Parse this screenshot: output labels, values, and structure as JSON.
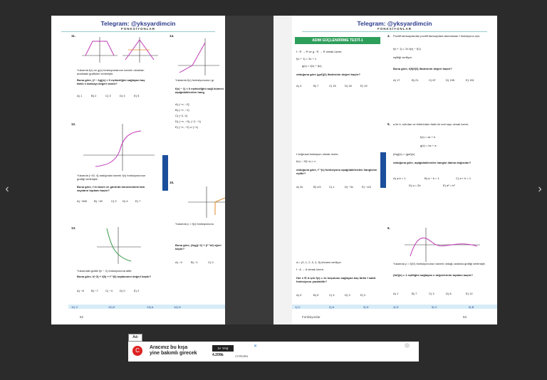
{
  "header": {
    "title": "Telegram: @yksyardimcin",
    "subtitle": "FONKSİYONLAR"
  },
  "left": {
    "q11": {
      "num": "11.",
      "desc": "Yukarıda f(x) ve g(x) fonksiyonlarının tanımlı oldukları aralıktaki grafikleri verilmiştir.",
      "q": "Buna göre, (f − 2g)(x) < 0 eşitsizliğini sağlayan kaç farklı x tamsayı değeri vardır?",
      "opts": [
        "A) 1",
        "B) 2",
        "C) 3",
        "D) 4",
        "E) 5"
      ]
    },
    "q12": {
      "num": "12.",
      "desc": "Yukarıda [−40, 4] aralığında tanımlı f(x) fonksiyonunun grafiği verilmiştir.",
      "q": "Buna göre, f in tanım ve görüntü kümesindeki tam sayıların toplamı kaçtır?",
      "opts": [
        "A) −840",
        "B) −40",
        "C) 0",
        "D) 4",
        "E) 7"
      ]
    },
    "q13": {
      "num": "13.",
      "desc": "Yukarıdaki grafik f(x − 2) fonksiyonuna aittir.",
      "q": "Buna göre, f(−3) + f(0) + f⁻¹(6) toplamının değeri kaçtır?",
      "opts": [
        "A) −8",
        "B) −7",
        "C) −4",
        "D) 0",
        "E) 2"
      ]
    },
    "q14": {
      "num": "14.",
      "desc": "Yukarıda f(x) fonksiyonunun gr",
      "q": "f(x) − 1) < 0 eşitsizliğini sağl kümesi aşağıdakilerden hang",
      "opts": [
        "A) (−∞, −2]",
        "B) (−∞, −1)",
        "C) (−2, 0)",
        "D) (−∞, −3), (−2, −1)",
        "E) (−∞, −2) ∪ (−1)"
      ]
    },
    "q15": {
      "num": "15.",
      "desc": "Yukarıda y = f(x) fonksiyonunu",
      "q": "Buna göre, (fog)(−2) + (f⁻¹of) eğeri kaçtır?",
      "opts": [
        "A) −4",
        "B) −1",
        "C) 0"
      ]
    },
    "answers": [
      "11) C",
      "12) E",
      "13) A",
      "14) D"
    ],
    "page_num": "52"
  },
  "right": {
    "test_title": "ADIM GÜÇLENDİRME TESTİ-1",
    "q1": {
      "num": "1.",
      "lines": [
        "f : R → R ve g : R → R olmak üzere,",
        "f(x + 1) = 3x + 1",
        "g(x) = f(x) + f(x)"
      ],
      "q": "olduğuna göre (gof)(2) ifadesinin değeri kaçtır?",
      "opts": [
        "A) 4",
        "B) 7",
        "C) 15",
        "D) 18",
        "E) 19"
      ]
    },
    "q2": {
      "num": "2.",
      "lines": [
        "f doğrusal fonksiyon olmak üzere,",
        "f(x) − 2f(−x) = x"
      ],
      "q": "olduğuna göre, f⁻¹(x) fonksiyonu aşağıdakilerden hangisine eşittir?",
      "opts": [
        "A) 3x",
        "B) x/3",
        "C) x",
        "D) −3x",
        "E) −x/3"
      ]
    },
    "q3": {
      "num": "3.",
      "lines": [
        "A = {0, 1, 2, 3, 4, 5} kümesi veriliyor.",
        "f : A → A olmak üzere,"
      ],
      "q": "Her x ∈ A için f(x) = 2x koşulunu sağlayan kaç farklı f sabit fonksiyonu yazılabilir?",
      "opts": [
        "A) 0",
        "B) 5",
        "C) 4",
        "D) 3",
        "E) 2"
      ]
    },
    "q4": {
      "num": "4.",
      "lines": [
        "Pozitif tamsayılardan pozitif tamsayılara tanımlanan f fonksiyonu için,",
        "f(x + 1) = 2x.f(x) − f(1)",
        "eşitliği veriliyor."
      ],
      "q": "Buna göre, f(5)/f(3) ifadesinin değeri kaçtır?",
      "opts": [
        "A) 17",
        "B) 21",
        "C) 67",
        "D) 135",
        "E) 151"
      ]
    },
    "q5": {
      "num": "5.",
      "lines": [
        "a ile b, sıfırdan ve birbirinden farklı iki reel sayı olmak üzere,",
        "f(x) = ax + b",
        "g(x) = bx + a",
        "(fog)(x) = (gof)(x)"
      ],
      "q": "olduğuna göre, aşağıdakilerden hangisi daima doğrudur?",
      "opts": [
        "A) a.b = 1",
        "B) a − b = 1",
        "C) a + b = 1",
        "D) a = 2b",
        "E) a² = b²"
      ]
    },
    "q6": {
      "num": "6.",
      "lines": [
        "Yukarıda y = f(2x) fonksiyonunun tanımlı olduğu aralıkta grafiği verilmiştir."
      ],
      "q": "(fof)(x) = 1 eşitliğini sağlayan x değerlerinin toplamı kaçtır?",
      "opts": [
        "A) 1",
        "B) 7",
        "C) 3",
        "D) 8",
        "E) 12"
      ]
    },
    "answers": [
      "1) C",
      "2) A",
      "3) D",
      "4) D",
      "5) C",
      "6) B"
    ],
    "footer_label": "Fonksiyonlar",
    "page_num": "53"
  },
  "side_tab": "AYT KAMPI",
  "nav": {
    "prev": "‹",
    "next": "›"
  },
  "ad": {
    "tag": "Adı",
    "headline_1": "Aracınız bu kışa",
    "headline_2": "yine bakımlı girecek",
    "badge": "3+ YAŞ",
    "price": "4.200₺",
    "brand": "CITROËN"
  }
}
